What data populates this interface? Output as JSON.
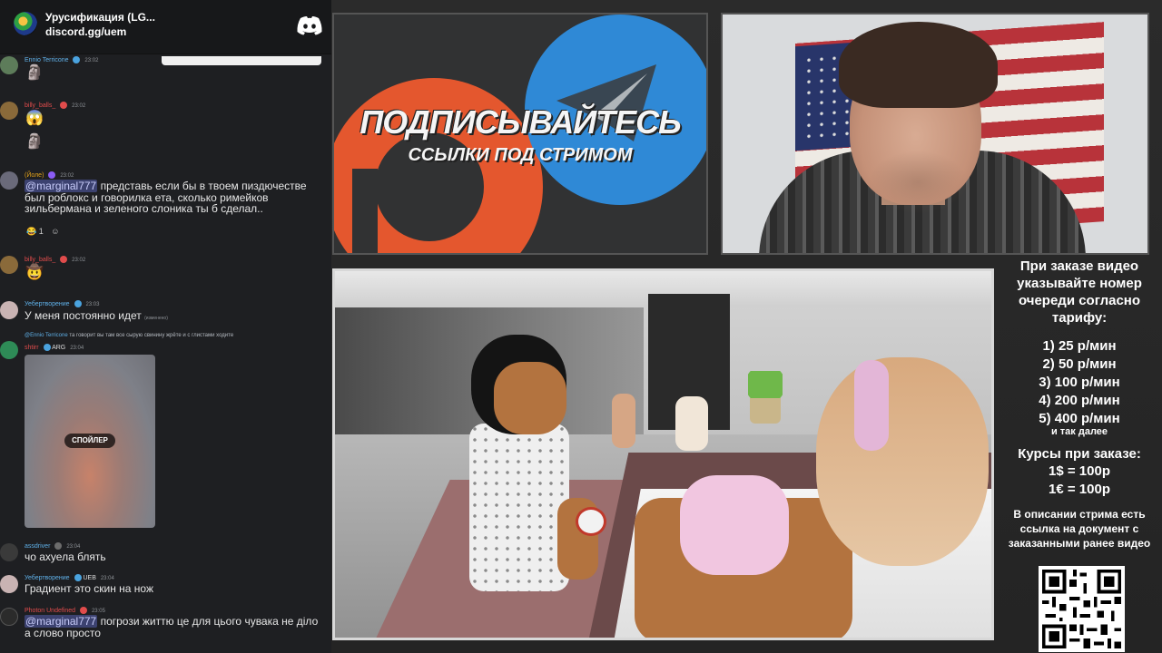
{
  "chat": {
    "server_name": "Урусификация (LG...",
    "invite_link": "discord.gg/uem",
    "messages": [
      {
        "author": "Ennio Terricone",
        "time": "23:02",
        "color": "#5fb0e8"
      },
      {
        "author": "billy_balls_",
        "time": "23:02",
        "color": "#e14c4c"
      },
      {
        "author": "(Йоле)",
        "time": "23:02",
        "color": "#e3a21a",
        "mention": "@marginal777",
        "text": "представь если бы в твоем пиздючестве был роблокс и говорилка ета, сколько римейков зильбермана и зеленого слоника ты б сделал..",
        "reaction_count": "1"
      },
      {
        "author": "billy_balls_",
        "time": "23:02",
        "color": "#e14c4c"
      },
      {
        "author": "Уебертворение",
        "time": "23:03",
        "color": "#5fb0e8",
        "text": "У меня постоянно идет",
        "edited": "(изменено)"
      },
      {
        "reply_author": "@Ennio Terricone",
        "reply_text": "та говорит вы там все сырую свинину жрёте и с глистами ходите",
        "author": "shtirr",
        "tag": "ARG",
        "time": "23:04",
        "color": "#e14c4c",
        "spoiler": "СПОЙЛЕР"
      },
      {
        "author": "assdriver",
        "time": "23:04",
        "color": "#5fb0e8",
        "text": "чо ахуела блять"
      },
      {
        "author": "Уебертворение",
        "tag": "UEB",
        "time": "23:04",
        "color": "#5fb0e8",
        "text": "Градиент это скин на нож"
      },
      {
        "author": "Photon Undefined",
        "time": "23:05",
        "color": "#e14c4c",
        "mention": "@marginal777",
        "text": "погрози життю це для цього чувака не діло а слово просто"
      }
    ],
    "tag_ueb": "UEB"
  },
  "banner": {
    "title": "ПОДПИСЫВАЙТЕСЬ",
    "subtitle": "ССЫЛКИ ПОД СТРИМОМ"
  },
  "info": {
    "heading": "При заказе видео указывайте номер очереди согласно тарифу:",
    "tariffs": [
      "1) 25 р/мин",
      "2) 50 р/мин",
      "3) 100 р/мин",
      "4) 200 р/мин",
      "5) 400 р/мин"
    ],
    "tariffs_more": "и так далее",
    "rates_title": "Курсы при заказе:",
    "rates": [
      "1$ = 100р",
      "1€ = 100р"
    ],
    "note": "В описании стрима есть ссылка на документ с заказанными ранее видео"
  }
}
